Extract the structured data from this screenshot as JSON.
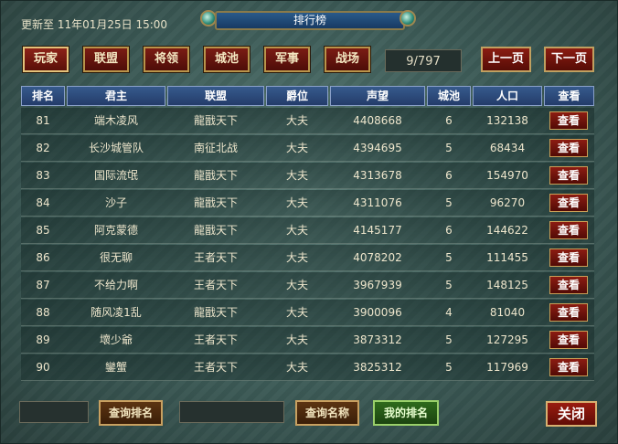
{
  "header": {
    "updated_text": "更新至 11年01月25日 15:00",
    "title": "排行榜"
  },
  "tabs": [
    {
      "label": "玩家",
      "active": true
    },
    {
      "label": "联盟",
      "active": false
    },
    {
      "label": "将领",
      "active": false
    },
    {
      "label": "城池",
      "active": false
    },
    {
      "label": "军事",
      "active": false
    },
    {
      "label": "战场",
      "active": false
    }
  ],
  "pager": {
    "indicator": "9/797",
    "prev_label": "上一页",
    "next_label": "下一页"
  },
  "table": {
    "columns": [
      "排名",
      "君主",
      "联盟",
      "爵位",
      "声望",
      "城池",
      "人口",
      "查看"
    ],
    "view_label": "查看",
    "rows": [
      {
        "rank": "81",
        "lord": "端木凌风",
        "alliance": "龍戩天下",
        "title": "大夫",
        "prestige": "4408668",
        "cities": "6",
        "population": "132138"
      },
      {
        "rank": "82",
        "lord": "长沙城管队",
        "alliance": "南征北战",
        "title": "大夫",
        "prestige": "4394695",
        "cities": "5",
        "population": "68434"
      },
      {
        "rank": "83",
        "lord": "国际流氓",
        "alliance": "龍戩天下",
        "title": "大夫",
        "prestige": "4313678",
        "cities": "6",
        "population": "154970"
      },
      {
        "rank": "84",
        "lord": "沙子",
        "alliance": "龍戩天下",
        "title": "大夫",
        "prestige": "4311076",
        "cities": "5",
        "population": "96270"
      },
      {
        "rank": "85",
        "lord": "阿克蒙德",
        "alliance": "龍戩天下",
        "title": "大夫",
        "prestige": "4145177",
        "cities": "6",
        "population": "144622"
      },
      {
        "rank": "86",
        "lord": "很无聊",
        "alliance": "王者天下",
        "title": "大夫",
        "prestige": "4078202",
        "cities": "5",
        "population": "111455"
      },
      {
        "rank": "87",
        "lord": "不给力啊",
        "alliance": "王者天下",
        "title": "大夫",
        "prestige": "3967939",
        "cities": "5",
        "population": "148125"
      },
      {
        "rank": "88",
        "lord": "随风凌1乱",
        "alliance": "龍戩天下",
        "title": "大夫",
        "prestige": "3900096",
        "cities": "4",
        "population": "81040"
      },
      {
        "rank": "89",
        "lord": "壞少爺",
        "alliance": "王者天下",
        "title": "大夫",
        "prestige": "3873312",
        "cities": "5",
        "population": "127295"
      },
      {
        "rank": "90",
        "lord": "鑾蟹",
        "alliance": "王者天下",
        "title": "大夫",
        "prestige": "3825312",
        "cities": "5",
        "population": "117969"
      }
    ]
  },
  "footer": {
    "rank_input_value": "",
    "query_rank_label": "查询排名",
    "name_input_value": "",
    "query_name_label": "查询名称",
    "my_rank_label": "我的排名",
    "close_label": "关闭"
  }
}
